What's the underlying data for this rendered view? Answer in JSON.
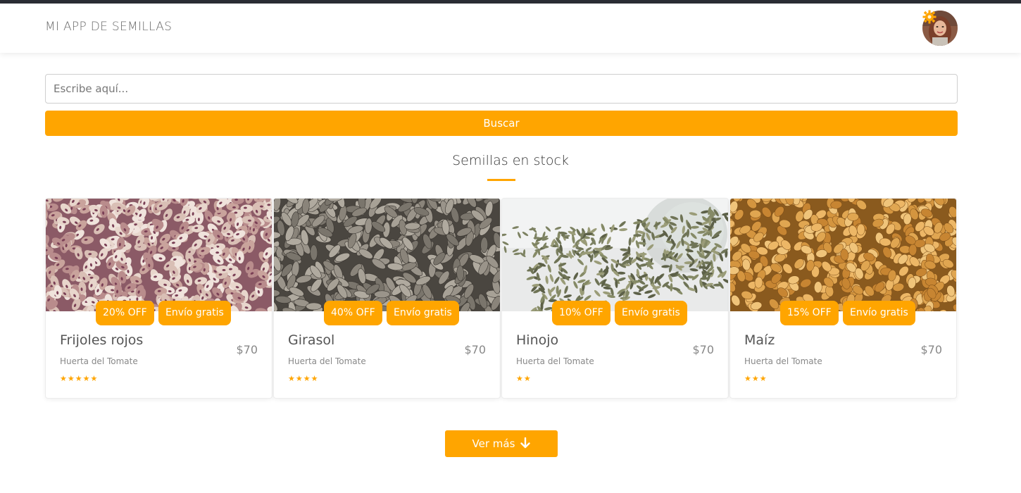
{
  "header": {
    "brand": "MI APP DE SEMILLAS",
    "avatar_icon": "user-avatar",
    "settings_icon": "gear-icon"
  },
  "search": {
    "placeholder": "Escribe aquí...",
    "value": "",
    "button_label": "Buscar"
  },
  "section": {
    "title": "Semillas en stock"
  },
  "products": [
    {
      "name": "Frijoles rojos",
      "vendor": "Huerta del Tomate",
      "price": "$70",
      "discount": "20% OFF",
      "shipping": "Envío gratis",
      "rating": 5,
      "stars": "★★★★★",
      "image": "pinto-beans"
    },
    {
      "name": "Girasol",
      "vendor": "Huerta del Tomate",
      "price": "$70",
      "discount": "40% OFF",
      "shipping": "Envío gratis",
      "rating": 4,
      "stars": "★★★★",
      "image": "sunflower-seeds"
    },
    {
      "name": "Hinojo",
      "vendor": "Huerta del Tomate",
      "price": "$70",
      "discount": "10% OFF",
      "shipping": "Envío gratis",
      "rating": 2,
      "stars": "★★",
      "image": "fennel-seeds-jar"
    },
    {
      "name": "Maíz",
      "vendor": "Huerta del Tomate",
      "price": "$70",
      "discount": "15% OFF",
      "shipping": "Envío gratis",
      "rating": 3,
      "stars": "★★★",
      "image": "wheat-grains"
    }
  ],
  "more": {
    "label": "Ver más",
    "icon": "arrow-down-icon"
  },
  "colors": {
    "accent": "#ffa500",
    "topbar": "#2b2d35"
  }
}
